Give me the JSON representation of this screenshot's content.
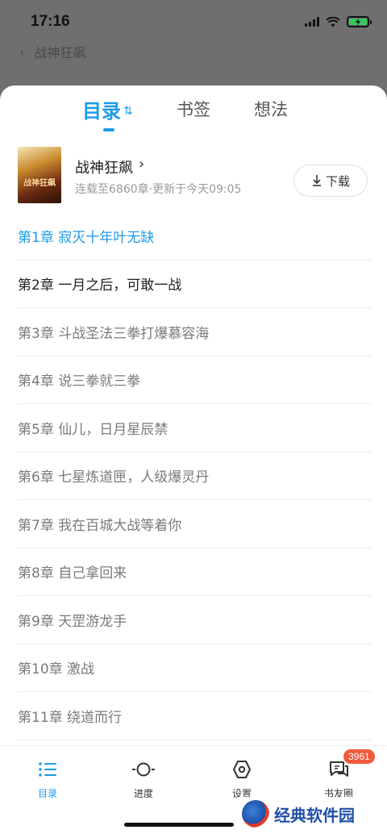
{
  "status_bar": {
    "time": "17:16"
  },
  "background_header": {
    "back_icon": "chevron-left-icon",
    "title": "战神狂飙"
  },
  "tabs": [
    {
      "label": "目录",
      "active": true
    },
    {
      "label": "书签",
      "active": false
    },
    {
      "label": "想法",
      "active": false
    }
  ],
  "sort_icon": "sort-arrows-icon",
  "book": {
    "cover_text": "战神狂飙",
    "title": "战神狂飙",
    "subtitle": "连载至6860章·更新于今天09:05",
    "download_label": "下载"
  },
  "chapters": [
    {
      "label": "第1章  寂灭十年叶无缺",
      "state": "current"
    },
    {
      "label": "第2章  一月之后，可敢一战",
      "state": "read"
    },
    {
      "label": "第3章  斗战圣法三拳打爆慕容海",
      "state": "unread"
    },
    {
      "label": "第4章  说三拳就三拳",
      "state": "unread"
    },
    {
      "label": "第5章  仙儿，日月星辰禁",
      "state": "unread"
    },
    {
      "label": "第6章  七星炼道匣，人级爆灵丹",
      "state": "unread"
    },
    {
      "label": "第7章  我在百城大战等着你",
      "state": "unread"
    },
    {
      "label": "第8章  自己拿回来",
      "state": "unread"
    },
    {
      "label": "第9章  天罡游龙手",
      "state": "unread"
    },
    {
      "label": "第10章  激战",
      "state": "unread"
    },
    {
      "label": "第11章  绕道而行",
      "state": "unread"
    }
  ],
  "bottom_bar": [
    {
      "label": "目录",
      "icon": "list-icon",
      "active": true
    },
    {
      "label": "进度",
      "icon": "progress-icon",
      "active": false
    },
    {
      "label": "设置",
      "icon": "settings-icon",
      "active": false
    },
    {
      "label": "书友圈",
      "icon": "chat-icon",
      "active": false,
      "badge": "3961"
    }
  ],
  "watermark": {
    "text": "经典软件园"
  },
  "colors": {
    "accent": "#1e9be8",
    "badge": "#f05a3c"
  }
}
